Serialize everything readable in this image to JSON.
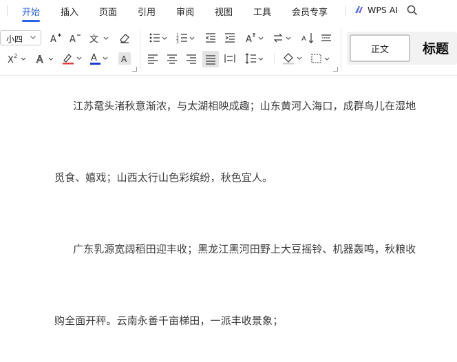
{
  "menubar": {
    "tabs": [
      {
        "label": "开始",
        "active": true
      },
      {
        "label": "插入"
      },
      {
        "label": "页面"
      },
      {
        "label": "引用"
      },
      {
        "label": "审阅"
      },
      {
        "label": "视图"
      },
      {
        "label": "工具"
      },
      {
        "label": "会员专享"
      }
    ],
    "wps_ai_label": "WPS AI"
  },
  "ribbon": {
    "font_size": "小四",
    "styles": {
      "normal": "正文",
      "heading": "标题"
    },
    "colors": {
      "accent": "#2a62e8",
      "font_color": "#1a3ccf",
      "highlight_color": "#e23e3e"
    }
  },
  "document": {
    "paragraphs": [
      "江苏鼋头渚秋意渐浓，与太湖相映成趣；山东黄河入海口，成群鸟儿在湿地",
      "觅食、嬉戏；山西太行山色彩缤纷，秋色宜人。",
      "广东乳源宽阔稻田迎丰收；黑龙江黑河田野上大豆摇铃、机器轰鸣，秋粮收",
      "购全面开秤。云南永善千亩梯田，一派丰收景象；"
    ]
  }
}
